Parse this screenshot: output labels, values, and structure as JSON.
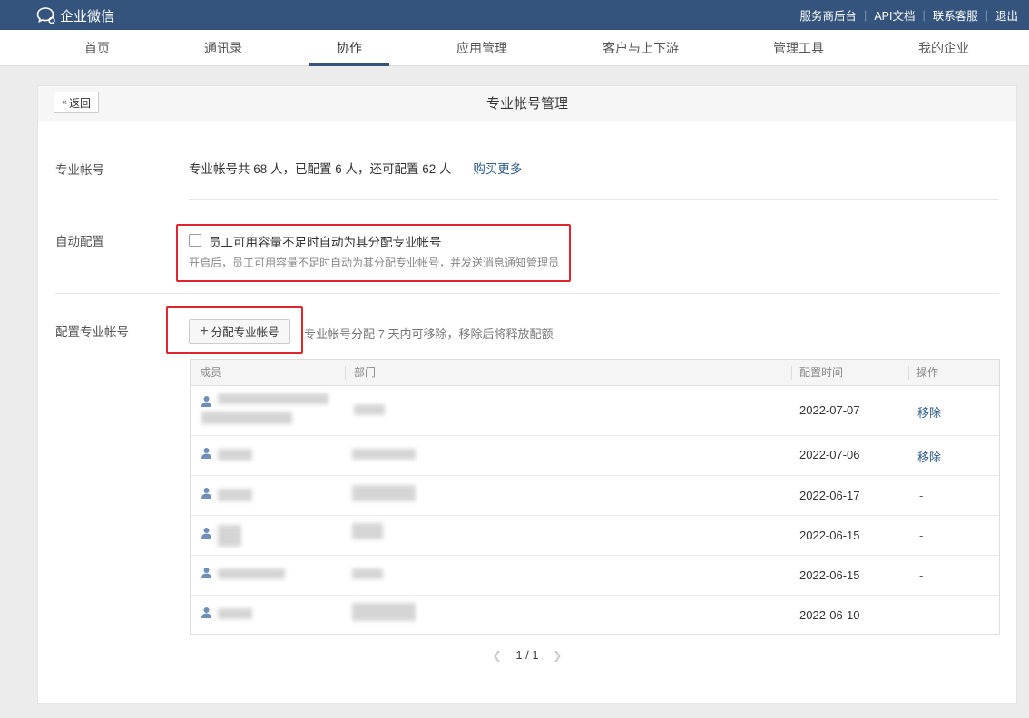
{
  "brand": {
    "name": "企业微信",
    "accent": "#34547d"
  },
  "toplinks": [
    "服务商后台",
    "API文档",
    "联系客服",
    "退出"
  ],
  "nav": {
    "items": [
      "首页",
      "通讯录",
      "协作",
      "应用管理",
      "客户与上下游",
      "管理工具",
      "我的企业"
    ],
    "active": "协作"
  },
  "panel": {
    "back_label": "返回",
    "title": "专业帐号管理"
  },
  "account": {
    "label": "专业帐号",
    "summary": "专业帐号共 68 人，已配置 6 人，还可配置 62 人",
    "buy_more": "购买更多"
  },
  "auto": {
    "label": "自动配置",
    "checkbox_label": "员工可用容量不足时自动为其分配专业帐号",
    "checked": false,
    "hint": "开启后，员工可用容量不足时自动为其分配专业帐号，并发送消息通知管理员"
  },
  "assign": {
    "label": "配置专业帐号",
    "button": "分配专业帐号",
    "note": "专业帐号分配 7 天内可移除，移除后将释放配额"
  },
  "table": {
    "columns": [
      "成员",
      "部门",
      "配置时间",
      "操作"
    ],
    "rows": [
      {
        "date": "2022-07-07",
        "action": "移除"
      },
      {
        "date": "2022-07-06",
        "action": "移除"
      },
      {
        "date": "2022-06-17",
        "action": "-"
      },
      {
        "date": "2022-06-15",
        "action": "-"
      },
      {
        "date": "2022-06-15",
        "action": "-"
      },
      {
        "date": "2022-06-10",
        "action": "-"
      }
    ]
  },
  "pager": {
    "text": "1 / 1"
  },
  "colors": {
    "highlight_box": "#e0262c",
    "link": "#2b5a8b"
  }
}
